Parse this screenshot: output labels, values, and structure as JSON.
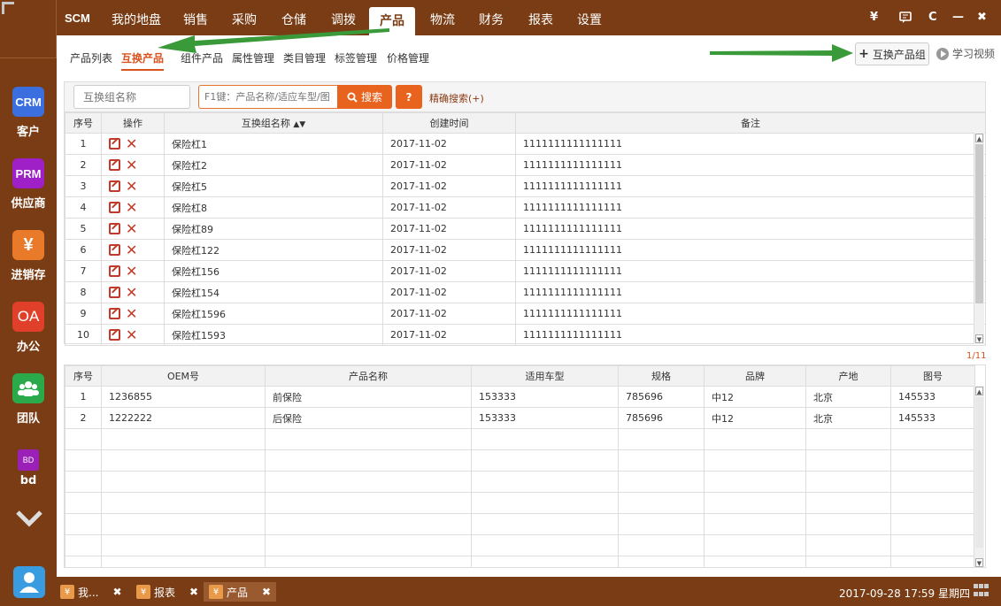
{
  "sidebar": {
    "apps": [
      {
        "tile": "CRM",
        "label": "客户",
        "color": "#3b6fe0"
      },
      {
        "tile": "PRM",
        "label": "供应商",
        "color": "#a020c8"
      },
      {
        "tile": "¥",
        "label": "进销存",
        "color": "#e87a2a"
      },
      {
        "tile": "OA",
        "label": "办公",
        "color": "#e0402a"
      },
      {
        "tile": "",
        "label": "团队",
        "color": "#2aaa4a"
      },
      {
        "tile": "BD",
        "label": "bd",
        "color": "#9a20b8"
      }
    ]
  },
  "topnav": {
    "brand": "SCM",
    "items": [
      "我的地盘",
      "销售",
      "采购",
      "仓储",
      "调拨",
      "产品",
      "物流",
      "财务",
      "报表",
      "设置"
    ],
    "active": "产品",
    "icons": {
      "yen": "¥",
      "refresh": "C",
      "min": "—",
      "close": "✖"
    }
  },
  "subnav": {
    "items": [
      "产品列表",
      "互换产品",
      "组件产品",
      "属性管理",
      "类目管理",
      "标签管理",
      "价格管理"
    ],
    "active": "互换产品",
    "add_button": "互换产品组",
    "learn_video": "学习视频"
  },
  "search": {
    "group_placeholder": "互换组名称",
    "product_placeholder": "F1键：产品名称/适应车型/图",
    "search_button": "搜索",
    "help": "?",
    "advanced": "精确搜索(+)"
  },
  "top_table": {
    "headers": [
      "序号",
      "操作",
      "互换组名称",
      "创建时间",
      "备注"
    ],
    "rows": [
      {
        "no": "1",
        "name": "保险杠1",
        "date": "2017-11-02",
        "note": "1111111111111111"
      },
      {
        "no": "2",
        "name": "保险杠2",
        "date": "2017-11-02",
        "note": "1111111111111111"
      },
      {
        "no": "3",
        "name": "保险杠5",
        "date": "2017-11-02",
        "note": "1111111111111111"
      },
      {
        "no": "4",
        "name": "保险杠8",
        "date": "2017-11-02",
        "note": "1111111111111111"
      },
      {
        "no": "5",
        "name": "保险杠89",
        "date": "2017-11-02",
        "note": "1111111111111111"
      },
      {
        "no": "6",
        "name": "保险杠122",
        "date": "2017-11-02",
        "note": "1111111111111111"
      },
      {
        "no": "7",
        "name": "保险杠156",
        "date": "2017-11-02",
        "note": "1111111111111111"
      },
      {
        "no": "8",
        "name": "保险杠154",
        "date": "2017-11-02",
        "note": "1111111111111111"
      },
      {
        "no": "9",
        "name": "保险杠1596",
        "date": "2017-11-02",
        "note": "1111111111111111"
      },
      {
        "no": "10",
        "name": "保险杠1593",
        "date": "2017-11-02",
        "note": "1111111111111111"
      }
    ]
  },
  "pager": "1/11",
  "bottom_table": {
    "headers": [
      "序号",
      "OEM号",
      "产品名称",
      "适用车型",
      "规格",
      "品牌",
      "产地",
      "图号"
    ],
    "rows": [
      {
        "no": "1",
        "oem": "1236855",
        "name": "前保险",
        "model": "153333",
        "spec": "785696",
        "brand": "中12",
        "origin": "北京",
        "drawing": "145533"
      },
      {
        "no": "2",
        "oem": "1222222",
        "name": "后保险",
        "model": "153333",
        "spec": "785696",
        "brand": "中12",
        "origin": "北京",
        "drawing": "145533"
      }
    ]
  },
  "taskbar": {
    "tasks": [
      {
        "label": "我...",
        "icon": "¥"
      },
      {
        "label": "报表",
        "icon": "¥"
      },
      {
        "label": "产品",
        "icon": "¥"
      }
    ],
    "clock": "2017-09-28 17:59 星期四"
  }
}
